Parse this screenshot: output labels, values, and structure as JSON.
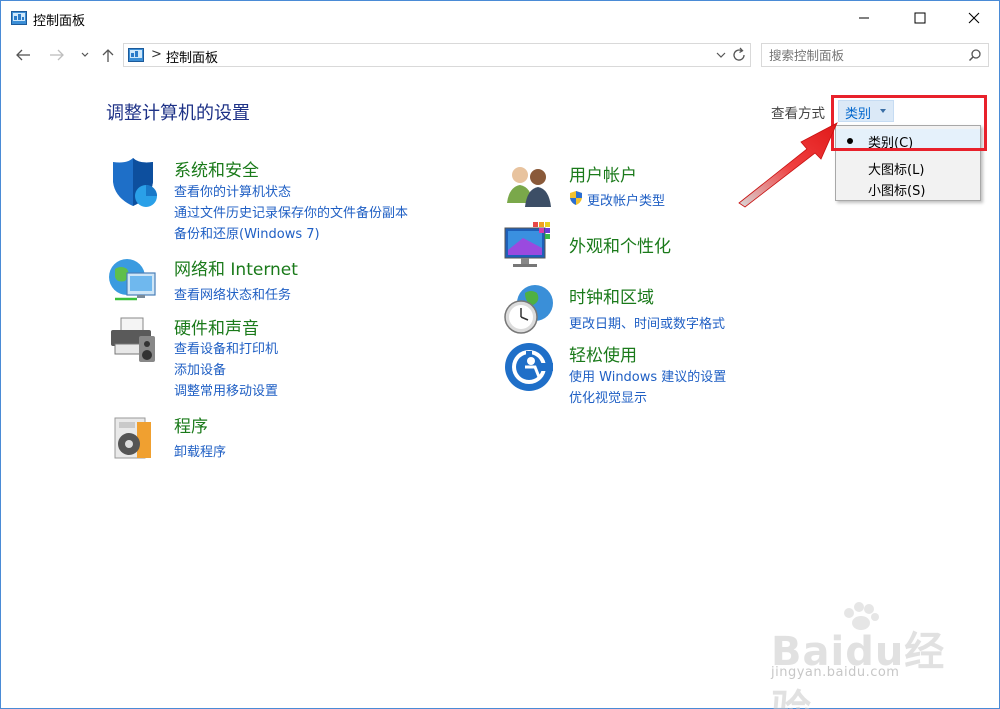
{
  "window": {
    "title": "控制面板",
    "minimize_icon": "minimize-icon",
    "maximize_icon": "maximize-icon",
    "close_icon": "close-icon"
  },
  "nav": {
    "breadcrumb_separator": ">",
    "breadcrumb": "控制面板",
    "search_placeholder": "搜索控制面板"
  },
  "header": {
    "title": "调整计算机的设置",
    "view_by_label": "查看方式",
    "view_by_value": "类别"
  },
  "view_menu": {
    "items": [
      {
        "label": "类别(C)",
        "selected": true
      },
      {
        "label": "大图标(L)",
        "selected": false
      },
      {
        "label": "小图标(S)",
        "selected": false
      }
    ]
  },
  "categories": {
    "system": {
      "title": "系统和安全",
      "icon": "shield-icon",
      "links": [
        "查看你的计算机状态",
        "通过文件历史记录保存你的文件备份副本",
        "备份和还原(Windows 7)"
      ]
    },
    "network": {
      "title": "网络和 Internet",
      "icon": "network-globe-icon",
      "links": [
        "查看网络状态和任务"
      ]
    },
    "hardware": {
      "title": "硬件和声音",
      "icon": "printer-speaker-icon",
      "links": [
        "查看设备和打印机",
        "添加设备",
        "调整常用移动设置"
      ]
    },
    "programs": {
      "title": "程序",
      "icon": "programs-disc-icon",
      "links": [
        "卸载程序"
      ]
    },
    "users": {
      "title": "用户帐户",
      "icon": "users-icon",
      "links": [
        "更改帐户类型"
      ]
    },
    "appearance": {
      "title": "外观和个性化",
      "icon": "monitor-palette-icon",
      "links": []
    },
    "clock": {
      "title": "时钟和区域",
      "icon": "clock-globe-icon",
      "links": [
        "更改日期、时间或数字格式"
      ]
    },
    "ease": {
      "title": "轻松使用",
      "icon": "ease-of-access-icon",
      "links": [
        "使用 Windows 建议的设置",
        "优化视觉显示"
      ]
    }
  },
  "watermark": {
    "brand": "Baidu经验",
    "url": "jingyan.baidu.com"
  },
  "colors": {
    "heading_green": "#1a7a1a",
    "link_blue": "#1f5fc4",
    "title_navy": "#1e3287",
    "highlight_red": "#e8212b"
  }
}
